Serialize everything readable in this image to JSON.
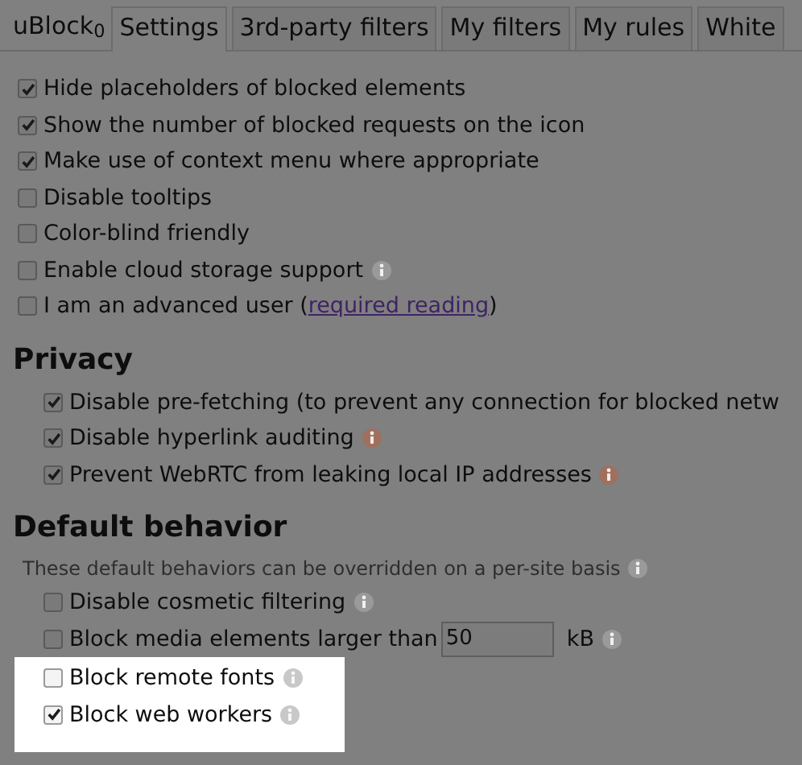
{
  "brand": "uBlock$_{0}$",
  "tabs": [
    {
      "label": "Settings",
      "selected": true
    },
    {
      "label": "3rd-party filters",
      "selected": false
    },
    {
      "label": "My filters",
      "selected": false
    },
    {
      "label": "My rules",
      "selected": false
    },
    {
      "label": "White",
      "selected": false
    }
  ],
  "general": [
    {
      "label": "Hide placeholders of blocked elements",
      "checked": true
    },
    {
      "label": "Show the number of blocked requests on the icon",
      "checked": true
    },
    {
      "label": "Make use of context menu where appropriate",
      "checked": true
    },
    {
      "label": "Disable tooltips",
      "checked": false
    },
    {
      "label": "Color-blind friendly",
      "checked": false
    },
    {
      "label": "Enable cloud storage support",
      "checked": false,
      "info": true,
      "warning": false
    },
    {
      "label": "I am an advanced user (",
      "link": "required reading",
      "label_after": ")",
      "checked": false
    }
  ],
  "sections": [
    {
      "title": "Privacy",
      "options": [
        {
          "label": "Disable pre-fetching (to prevent any connection for blocked netw",
          "checked": true
        },
        {
          "label": "Disable hyperlink auditing",
          "checked": true,
          "info": true,
          "warning": true
        },
        {
          "label": "Prevent WebRTC from leaking local IP addresses",
          "checked": true,
          "info": true,
          "warning": true
        }
      ]
    },
    {
      "title": "Default behavior",
      "note": "These default behaviors can be overridden on a per-site basis",
      "note_info": true,
      "options": [
        {
          "label": "Disable cosmetic filtering",
          "checked": false,
          "info": true,
          "warning": false,
          "highlighted": false
        },
        {
          "kind": "input",
          "label": "Block media elements larger than",
          "value": "50",
          "unit": "kB",
          "checked": false,
          "info": true,
          "warning": false,
          "highlighted": false
        },
        {
          "label": "Block remote fonts",
          "checked": false,
          "info": true,
          "warning": false,
          "highlighted": true
        },
        {
          "label": "Block web workers",
          "checked": true,
          "info": true,
          "warning": false,
          "highlighted": true
        }
      ]
    }
  ]
}
